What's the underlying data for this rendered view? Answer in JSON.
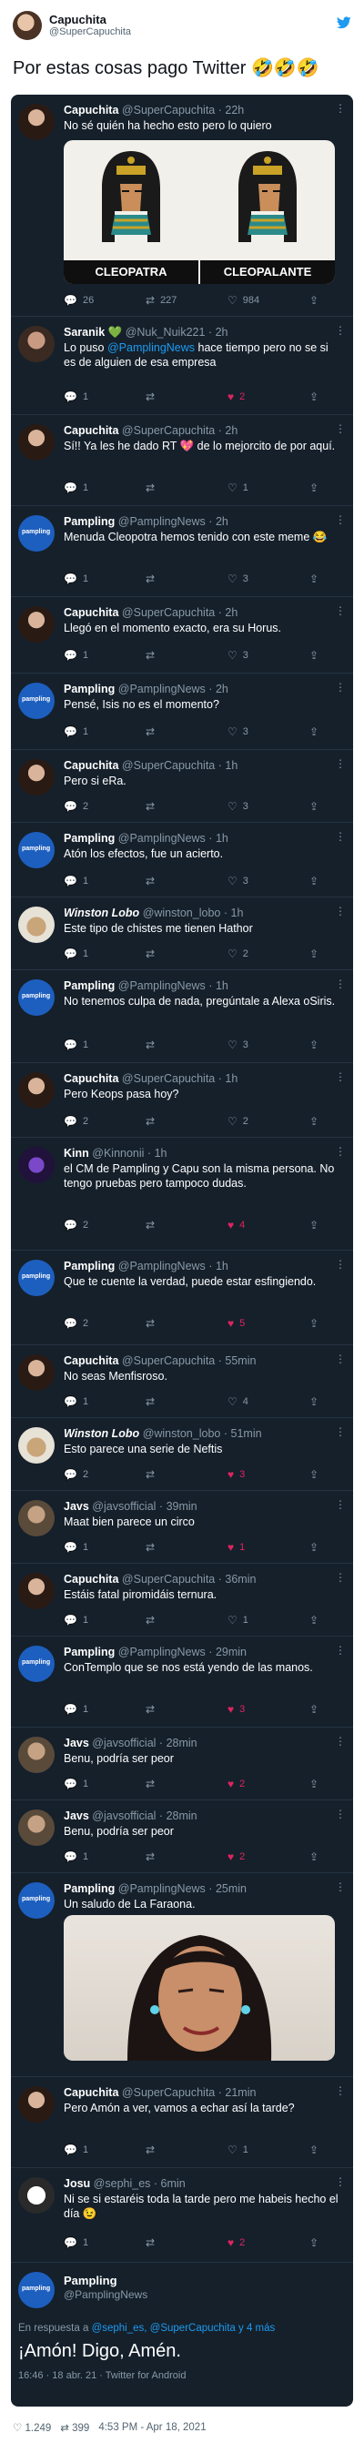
{
  "outer": {
    "name": "Capuchita",
    "handle": "@SuperCapuchita",
    "text": "Por estas cosas pago Twitter 🤣🤣🤣",
    "footer": {
      "likes": "1.249",
      "retweets": "399",
      "time": "4:53 PM - Apr 18, 2021"
    }
  },
  "tweets": [
    {
      "name": "Capuchita",
      "handle": "@SuperCapuchita",
      "time": "22h",
      "text": "No sé quién ha hecho esto pero lo quiero",
      "reply": "26",
      "rt": "227",
      "like": "984",
      "image": {
        "left_caption": "CLEOPATRA",
        "right_caption": "CLEOPALANTE"
      }
    },
    {
      "name": "Saranik 💚",
      "handle": "@Nuk_Nuik221",
      "time": "2h",
      "text_pre": "Lo puso ",
      "mention": "@PamplingNews",
      "text_post": " hace tiempo pero no se si es de alguien de esa empresa",
      "reply": "1",
      "rt": "",
      "like": "2"
    },
    {
      "name": "Capuchita",
      "handle": "@SuperCapuchita",
      "time": "2h",
      "text": "Sí!! Ya les he dado RT 💖 de lo mejorcito de por aquí.",
      "reply": "1",
      "rt": "",
      "like": "1"
    },
    {
      "name": "Pampling",
      "handle": "@PamplingNews",
      "time": "2h",
      "text": "Menuda Cleopotra hemos tenido con este meme 😂",
      "reply": "1",
      "rt": "",
      "like": "3"
    },
    {
      "name": "Capuchita",
      "handle": "@SuperCapuchita",
      "time": "2h",
      "text": "Llegó en el momento exacto, era su Horus.",
      "reply": "1",
      "rt": "",
      "like": "3"
    },
    {
      "name": "Pampling",
      "handle": "@PamplingNews",
      "time": "2h",
      "text": "Pensé, Isis no es el momento?",
      "reply": "1",
      "rt": "",
      "like": "3"
    },
    {
      "name": "Capuchita",
      "handle": "@SuperCapuchita",
      "time": "1h",
      "text": "Pero si eRa.",
      "reply": "2",
      "rt": "",
      "like": "3"
    },
    {
      "name": "Pampling",
      "handle": "@PamplingNews",
      "time": "1h",
      "text": "Atón los efectos, fue un acierto.",
      "reply": "1",
      "rt": "",
      "like": "3"
    },
    {
      "name": "Winston Lobo",
      "handle": "@winston_lobo",
      "time": "1h",
      "text": "Este tipo de chistes me tienen Hathor",
      "reply": "1",
      "rt": "",
      "like": "2"
    },
    {
      "name": "Pampling",
      "handle": "@PamplingNews",
      "time": "1h",
      "text": "No tenemos culpa de nada, pregúntale a Alexa oSiris.",
      "reply": "1",
      "rt": "",
      "like": "3"
    },
    {
      "name": "Capuchita",
      "handle": "@SuperCapuchita",
      "time": "1h",
      "text": "Pero Keops pasa hoy?",
      "reply": "2",
      "rt": "",
      "like": "2"
    },
    {
      "name": "Kinn",
      "handle": "@Kinnonii",
      "time": "1h",
      "text": "el CM de Pampling y Capu son la misma persona. No tengo pruebas pero tampoco dudas.",
      "reply": "2",
      "rt": "",
      "like": "4"
    },
    {
      "name": "Pampling",
      "handle": "@PamplingNews",
      "time": "1h",
      "text": "Que te cuente la verdad, puede estar esfingiendo.",
      "reply": "2",
      "rt": "",
      "like": "5"
    },
    {
      "name": "Capuchita",
      "handle": "@SuperCapuchita",
      "time": "55min",
      "text": "No seas Menfisroso.",
      "reply": "1",
      "rt": "",
      "like": "4"
    },
    {
      "name": "Winston Lobo",
      "handle": "@winston_lobo",
      "time": "51min",
      "text": "Esto parece una serie de Neftis",
      "reply": "2",
      "rt": "",
      "like": "3"
    },
    {
      "name": "Javs",
      "handle": "@javsofficial",
      "time": "39min",
      "text": "Maat bien parece un circo",
      "reply": "1",
      "rt": "",
      "like": "1"
    },
    {
      "name": "Capuchita",
      "handle": "@SuperCapuchita",
      "time": "36min",
      "text": "Estáis fatal piromidáis ternura.",
      "reply": "1",
      "rt": "",
      "like": "1"
    },
    {
      "name": "Pampling",
      "handle": "@PamplingNews",
      "time": "29min",
      "text": "ConTemplo que se nos está yendo de las manos.",
      "reply": "1",
      "rt": "",
      "like": "3"
    },
    {
      "name": "Javs",
      "handle": "@javsofficial",
      "time": "28min",
      "text": "Benu, podría ser peor",
      "reply": "1",
      "rt": "",
      "like": "2"
    },
    {
      "name": "Javs",
      "handle": "@javsofficial",
      "time": "28min",
      "text": "Benu, podría ser peor",
      "reply": "1",
      "rt": "",
      "like": "2"
    },
    {
      "name": "Pampling",
      "handle": "@PamplingNews",
      "time": "25min",
      "text": "Un saludo de La Faraona.",
      "reply": "",
      "rt": "",
      "like": ""
    },
    {
      "name": "Capuchita",
      "handle": "@SuperCapuchita",
      "time": "21min",
      "text": "Pero Amón a ver, vamos a echar así la tarde?",
      "reply": "1",
      "rt": "",
      "like": "1"
    },
    {
      "name": "Josu",
      "handle": "@sephi_es",
      "time": "6min",
      "text": "Ni se si estaréis toda la tarde pero me habeis hecho el día 😉",
      "reply": "1",
      "rt": "",
      "like": "2"
    }
  ],
  "last": {
    "name": "Pampling",
    "handle": "@PamplingNews",
    "reply_label": "En respuesta a",
    "reply_handles": "@sephi_es, @SuperCapuchita y 4 más",
    "text": "¡Amón! Digo, Amén.",
    "stamp": "16:46 · 18 abr. 21 · Twitter for Android"
  },
  "colors": {
    "accent": "#1d9bf0",
    "like_red": "#e0245e",
    "bg_dark": "#15202b"
  }
}
